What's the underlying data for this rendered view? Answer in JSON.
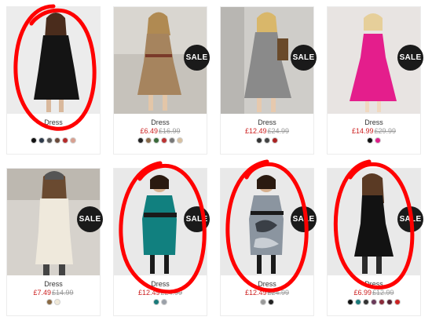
{
  "products": [
    {
      "title": "Dress",
      "sale_price": "",
      "old_price": "",
      "badge": "",
      "swatches": [
        "#111111",
        "#2e3a4a",
        "#555555",
        "#6b4a3a",
        "#b52a2a",
        "#d8a090"
      ],
      "dress_color": "#141414",
      "bg": "#ececec"
    },
    {
      "title": "Dress",
      "sale_price": "£6.49",
      "old_price": "£16.99",
      "badge": "SALE",
      "swatches": [
        "#222222",
        "#8a6a4a",
        "#3a6a3a",
        "#bb3333",
        "#777777",
        "#d8c0a0"
      ],
      "dress_color": "#a6845e",
      "bg": "#d9d6d0"
    },
    {
      "title": "Dress",
      "sale_price": "£12.49",
      "old_price": "£24.99",
      "badge": "SALE",
      "swatches": [
        "#333333",
        "#444444",
        "#aa2222"
      ],
      "dress_color": "#8a8a8a",
      "bg": "#cfcdc9"
    },
    {
      "title": "Dress",
      "sale_price": "£14.99",
      "old_price": "£29.99",
      "badge": "SALE",
      "swatches": [
        "#111111",
        "#e0208a"
      ],
      "dress_color": "#e41e8c",
      "bg": "#e8e4e2"
    },
    {
      "title": "Dress",
      "sale_price": "£7.49",
      "old_price": "£14.99",
      "badge": "SALE",
      "swatches": [
        "#8a6a44",
        "#efe8d8"
      ],
      "dress_color": "#efe9dc",
      "bg": "#d6d2cc"
    },
    {
      "title": "Dress",
      "sale_price": "£12.49",
      "old_price": "£24.99",
      "badge": "SALE",
      "swatches": [
        "#1a7a7a",
        "#9aa0a8"
      ],
      "dress_color": "#11807f",
      "bg": "#e9e9e9"
    },
    {
      "title": "Dress",
      "sale_price": "£12.49",
      "old_price": "£24.99",
      "badge": "SALE",
      "swatches": [
        "#999999",
        "#222222"
      ],
      "dress_color": "#8b95a0",
      "bg": "#e9e9e9"
    },
    {
      "title": "Dress",
      "sale_price": "£6.99",
      "old_price": "£12.99",
      "badge": "SALE",
      "swatches": [
        "#111111",
        "#1a7a7a",
        "#333333",
        "#6a3a5a",
        "#8a2a3a",
        "#552233",
        "#cc2222"
      ],
      "dress_color": "#121212",
      "bg": "#e9e9e9"
    }
  ],
  "annotation_color": "#ff0000"
}
